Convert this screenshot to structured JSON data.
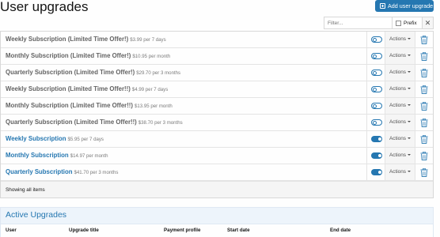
{
  "page": {
    "title": "User upgrades"
  },
  "toolbar": {
    "add_label": "Add user upgrade"
  },
  "filter": {
    "placeholder": "Filter...",
    "prefix_label": "Prefix",
    "clear_glyph": "✕"
  },
  "upgrades": [
    {
      "title": "Weekly Subscription (Limited Time Offer!)",
      "price": "$3.99 per 7 days",
      "active": false,
      "actions_label": "Actions"
    },
    {
      "title": "Monthly Subscription (Limited Time Offer!)",
      "price": "$10.95 per month",
      "active": false,
      "actions_label": "Actions"
    },
    {
      "title": "Quarterly Subscription (Limited Time Offer!)",
      "price": "$29.70 per 3 months",
      "active": false,
      "actions_label": "Actions"
    },
    {
      "title": "Weekly Subscription (Limited Time Offer!!)",
      "price": "$4.99 per 7 days",
      "active": false,
      "actions_label": "Actions"
    },
    {
      "title": "Monthly Subscription (Limited Time Offer!!)",
      "price": "$13.95 per month",
      "active": false,
      "actions_label": "Actions"
    },
    {
      "title": "Quarterly Subscription (Limited Time Offer!!)",
      "price": "$38.70 per 3 months",
      "active": false,
      "actions_label": "Actions"
    },
    {
      "title": "Weekly Subscription",
      "price": "$5.95 per 7 days",
      "active": true,
      "actions_label": "Actions"
    },
    {
      "title": "Monthly Subscription",
      "price": "$14.97 per month",
      "active": true,
      "actions_label": "Actions"
    },
    {
      "title": "Quarterly Subscription",
      "price": "$41.70 per 3 months",
      "active": true,
      "actions_label": "Actions"
    }
  ],
  "list_footer": {
    "text": "Showing all items"
  },
  "active_upgrades": {
    "heading": "Active Upgrades",
    "columns": [
      "User",
      "Upgrade title",
      "Payment profile",
      "Start date",
      "End date"
    ]
  },
  "colors": {
    "accent": "#2577b1",
    "inactive_title": "#636363",
    "header_band": "#edf4fb"
  },
  "icons": {
    "add": "plus-square-icon",
    "delete": "trash-icon",
    "toggle": "toggle-switch"
  }
}
